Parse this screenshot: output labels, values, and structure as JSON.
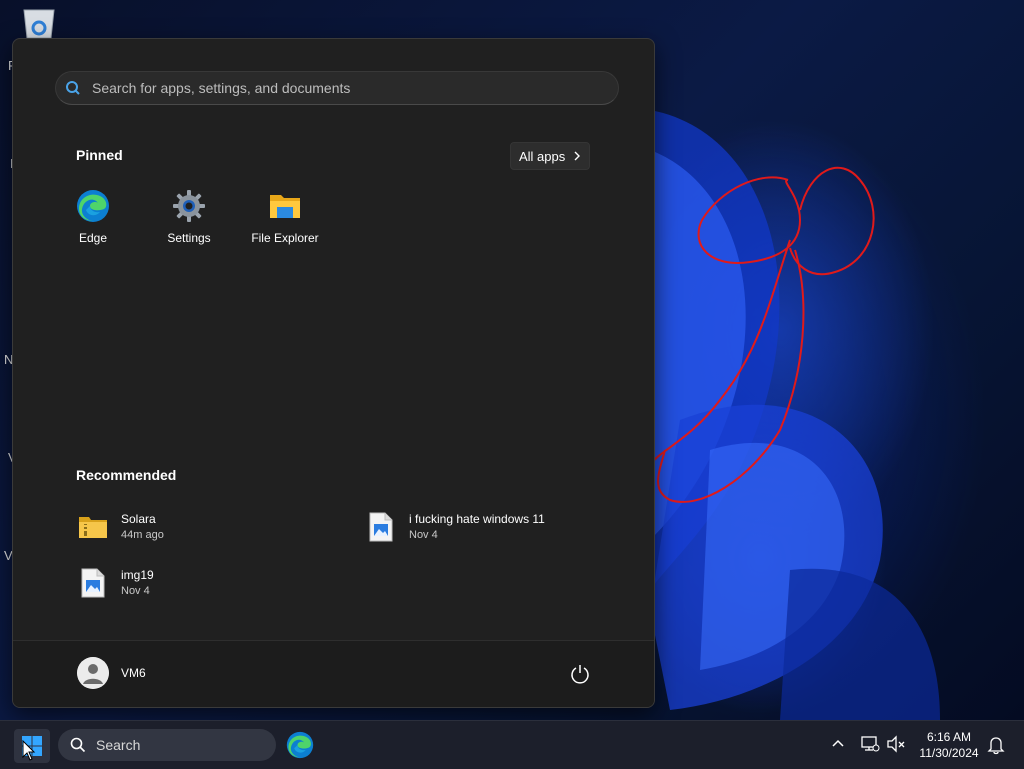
{
  "desktop": {
    "partial_labels": [
      "R",
      "I",
      "N",
      "V",
      "V"
    ]
  },
  "start_menu": {
    "search": {
      "placeholder": "Search for apps, settings, and documents",
      "value": ""
    },
    "pinned": {
      "title": "Pinned",
      "all_apps_label": "All apps",
      "apps": [
        {
          "label": "Edge",
          "icon": "edge-icon"
        },
        {
          "label": "Settings",
          "icon": "settings-gear-icon"
        },
        {
          "label": "File Explorer",
          "icon": "folder-icon"
        }
      ]
    },
    "recommended": {
      "title": "Recommended",
      "items": [
        {
          "name": "Solara",
          "time": "44m ago",
          "icon": "zip-folder-icon"
        },
        {
          "name": "i fucking hate windows 11",
          "time": "Nov 4",
          "icon": "image-file-icon"
        },
        {
          "name": "img19",
          "time": "Nov 4",
          "icon": "image-file-icon"
        }
      ]
    },
    "user": {
      "name": "VM6"
    }
  },
  "taskbar": {
    "search_label": "Search",
    "clock": {
      "time": "6:16 AM",
      "date": "11/30/2024"
    }
  },
  "colors": {
    "accent": "#0078d4",
    "menu_bg": "#202020",
    "scribble": "#e01a1a"
  }
}
